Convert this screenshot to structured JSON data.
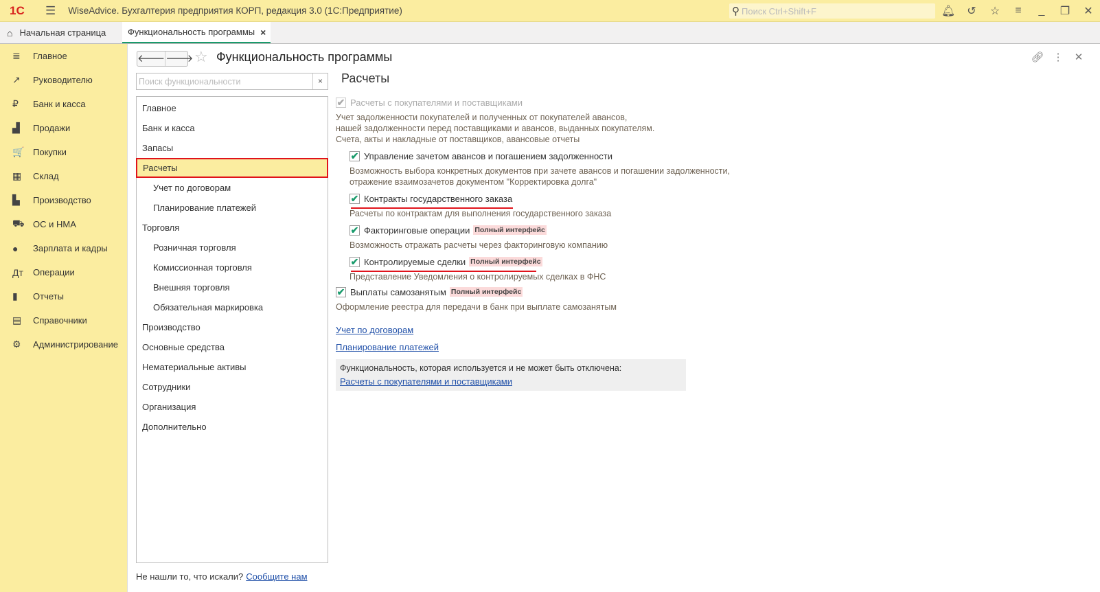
{
  "app": {
    "title": "WiseAdvice. Бухгалтерия предприятия КОРП, редакция 3.0  (1С:Предприятие)",
    "logo": "1С",
    "search_placeholder": "Поиск Ctrl+Shift+F"
  },
  "tabs": [
    {
      "label": "Начальная страница"
    },
    {
      "label": "Функциональность программы",
      "close": "×"
    }
  ],
  "sidebar": {
    "items": [
      {
        "label": "Главное",
        "icon": "≣"
      },
      {
        "label": "Руководителю",
        "icon": "↗"
      },
      {
        "label": "Банк и касса",
        "icon": "₽"
      },
      {
        "label": "Продажи",
        "icon": "▟"
      },
      {
        "label": "Покупки",
        "icon": "🛒"
      },
      {
        "label": "Склад",
        "icon": "▦"
      },
      {
        "label": "Производство",
        "icon": "▙"
      },
      {
        "label": "ОС и НМА",
        "icon": "⛟"
      },
      {
        "label": "Зарплата и кадры",
        "icon": "●"
      },
      {
        "label": "Операции",
        "icon": "Дт"
      },
      {
        "label": "Отчеты",
        "icon": "▮"
      },
      {
        "label": "Справочники",
        "icon": "▤"
      },
      {
        "label": "Администрирование",
        "icon": "⚙"
      }
    ]
  },
  "form": {
    "title": "Функциональность программы",
    "search_placeholder": "Поиск функциональности",
    "clear": "×",
    "nav": [
      {
        "label": "Главное"
      },
      {
        "label": "Банк и касса"
      },
      {
        "label": "Запасы"
      },
      {
        "label": "Расчеты",
        "selected": true
      },
      {
        "label": "Учет по договорам",
        "sub": true
      },
      {
        "label": "Планирование платежей",
        "sub": true
      },
      {
        "label": "Торговля"
      },
      {
        "label": "Розничная торговля",
        "sub": true
      },
      {
        "label": "Комиссионная торговля",
        "sub": true
      },
      {
        "label": "Внешняя торговля",
        "sub": true
      },
      {
        "label": "Обязательная маркировка",
        "sub": true
      },
      {
        "label": "Производство"
      },
      {
        "label": "Основные средства"
      },
      {
        "label": "Нематериальные активы"
      },
      {
        "label": "Сотрудники"
      },
      {
        "label": "Организация"
      },
      {
        "label": "Дополнительно"
      }
    ],
    "not_found": "Не нашли то, что искали?",
    "contact_link": "Сообщите нам"
  },
  "section": {
    "title": "Расчеты",
    "main_option": {
      "label": "Расчеты с покупателями и поставщиками",
      "checked": true,
      "disabled": true,
      "desc": [
        "Учет задолженности покупателей и полученных от покупателей авансов,",
        "нашей задолженности перед поставщиками и авансов, выданных покупателям.",
        "Счета, акты и накладные от поставщиков, авансовые отчеты"
      ]
    },
    "options": [
      {
        "label": "Управление зачетом авансов и погашением задолженности",
        "checked": true,
        "desc": [
          "Возможность выбора конкретных документов при зачете авансов и погашении задолженности,",
          "отражение взаимозачетов документом \"Корректировка долга\""
        ]
      },
      {
        "label": "Контракты государственного заказа",
        "checked": true,
        "highlighted": true,
        "desc": [
          "Расчеты по контрактам для выполнения государственного заказа"
        ]
      },
      {
        "label": "Факторинговые операции",
        "checked": true,
        "badge": "Полный интерфейс",
        "desc": [
          "Возможность отражать расчеты через факторинговую компанию"
        ]
      },
      {
        "label": "Контролируемые сделки",
        "checked": true,
        "badge": "Полный интерфейс",
        "highlighted": true,
        "desc": [
          "Представление Уведомления о контролируемых сделках в ФНС"
        ]
      }
    ],
    "selfemployed": {
      "label": "Выплаты самозанятым",
      "checked": true,
      "badge": "Полный интерфейс",
      "desc": "Оформление реестра для передачи в банк при выплате самозанятым"
    },
    "links": [
      "Учет по договорам",
      "Планирование платежей"
    ],
    "info": {
      "text": "Функциональность, которая используется и не может быть отключена:",
      "link": "Расчеты с покупателями и поставщиками"
    }
  },
  "colors": {
    "sidebar": "#fbeda0",
    "accent": "#1a9b6c",
    "highlight": "#e0131b",
    "link": "#1f4fa8"
  }
}
